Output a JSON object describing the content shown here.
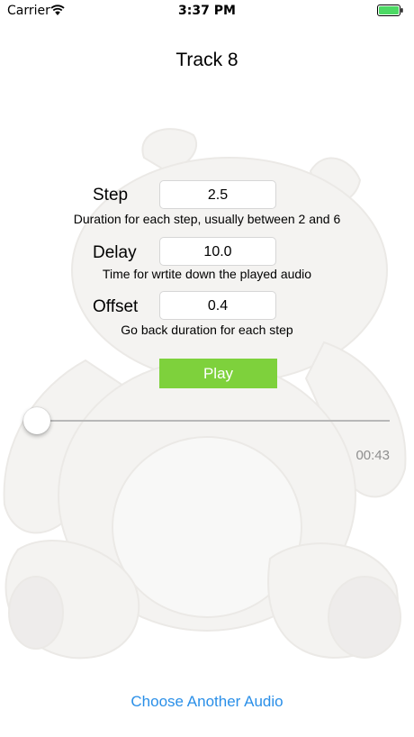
{
  "status_bar": {
    "carrier": "Carrier",
    "time": "3:37 PM",
    "battery_color": "#4cd964"
  },
  "title": "Track 8",
  "params": {
    "step": {
      "label": "Step",
      "value": "2.5",
      "description": "Duration for each step, usually between 2 and 6"
    },
    "delay": {
      "label": "Delay",
      "value": "10.0",
      "description": "Time for wrtite down the played audio"
    },
    "offset": {
      "label": "Offset",
      "value": "0.4",
      "description": "Go back duration for each step"
    }
  },
  "play_button": {
    "label": "Play",
    "color": "#7ed13c"
  },
  "player": {
    "progress": 0,
    "time_remaining": "00:43"
  },
  "choose_audio_label": "Choose Another Audio",
  "colors": {
    "link": "#2a8fe8",
    "accent": "#7ed13c"
  }
}
